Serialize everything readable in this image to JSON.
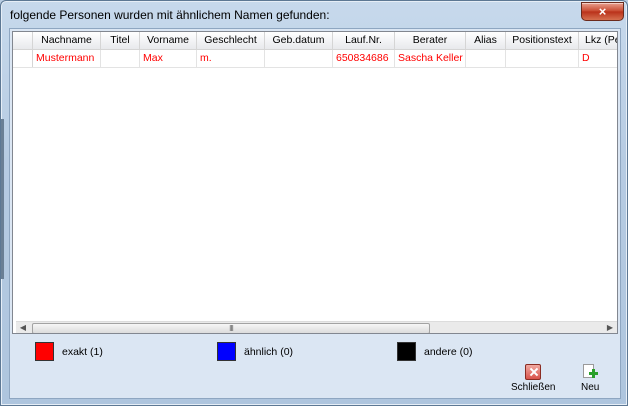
{
  "window": {
    "title": "folgende Personen wurden mit ähnlichem Namen gefunden:",
    "close_glyph": "×"
  },
  "grid": {
    "columns": [
      "Nachname",
      "Titel",
      "Vorname",
      "Geschlecht",
      "Geb.datum",
      "Lauf.Nr.",
      "Berater",
      "Alias",
      "Positionstext",
      "Lkz (Pe"
    ],
    "rows": [
      {
        "color": "#ff0000",
        "cells": [
          "Mustermann",
          "",
          "Max",
          "m.",
          "",
          "650834686",
          "Sascha Keller",
          "",
          "",
          "D"
        ]
      }
    ],
    "scroll_left_glyph": "◀",
    "scroll_right_glyph": "▶",
    "scroll_thumb_grip": "III"
  },
  "legend": [
    {
      "label": "exakt (1)",
      "color": "#ff0000"
    },
    {
      "label": "ähnlich (0)",
      "color": "#0000ff"
    },
    {
      "label": "andere (0)",
      "color": "#000000"
    }
  ],
  "buttons": {
    "close_label": "Schließen",
    "close_icon": "close-x-icon",
    "new_label": "Neu",
    "new_icon": "new-document-plus-icon"
  }
}
